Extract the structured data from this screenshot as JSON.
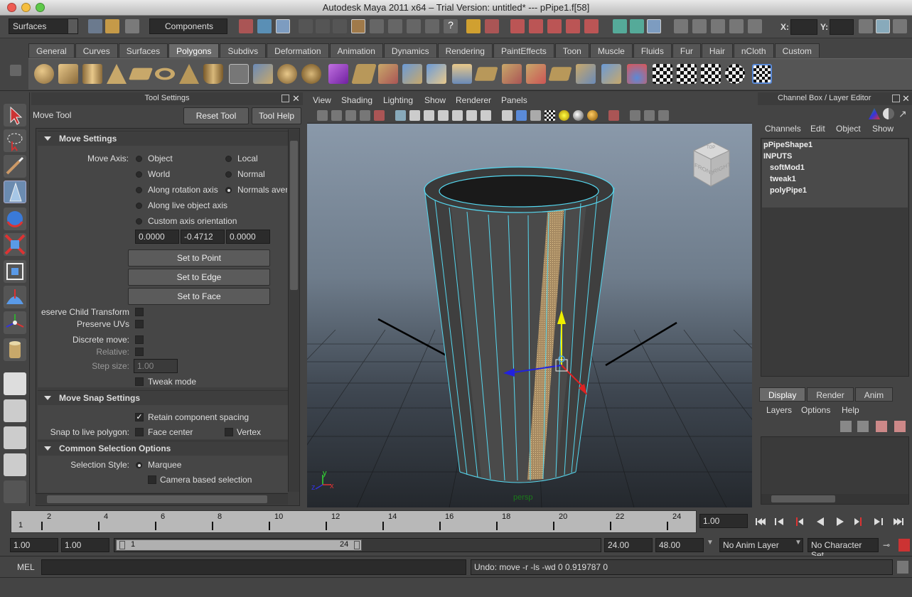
{
  "window": {
    "title": "Autodesk Maya 2011 x64 – Trial Version: untitled*   ---   pPipe1.f[58]",
    "traffic_colors": [
      "#ee5b52",
      "#f5be3f",
      "#5ec94a"
    ]
  },
  "statusline": {
    "menuset": "Surfaces",
    "selection_mode": "Components",
    "x_label": "X:",
    "y_label": "Y:"
  },
  "shelf": {
    "tabs": [
      "General",
      "Curves",
      "Surfaces",
      "Polygons",
      "Subdivs",
      "Deformation",
      "Animation",
      "Dynamics",
      "Rendering",
      "PaintEffects",
      "Toon",
      "Muscle",
      "Fluids",
      "Fur",
      "Hair",
      "nCloth",
      "Custom"
    ],
    "active_tab": "Polygons"
  },
  "tool_settings": {
    "panel_title": "Tool Settings",
    "tool_name": "Move Tool",
    "reset_label": "Reset Tool",
    "help_label": "Tool Help",
    "move_settings": {
      "header": "Move Settings",
      "move_axis_label": "Move Axis:",
      "opt_object": "Object",
      "opt_local": "Local",
      "opt_world": "World",
      "opt_normal": "Normal",
      "opt_rotation_axis": "Along rotation axis",
      "opt_normals_avg": "Normals aver",
      "opt_live_object": "Along live object axis",
      "opt_custom": "Custom axis orientation",
      "axis_x": "0.0000",
      "axis_y": "-0.4712",
      "axis_z": "0.0000",
      "set_point": "Set to Point",
      "set_edge": "Set to Edge",
      "set_face": "Set to Face",
      "preserve_child": "eserve Child Transform",
      "preserve_uvs": "Preserve UVs",
      "discrete_move": "Discrete move:",
      "relative": "Relative:",
      "step_size": "Step size:",
      "step_value": "1.00",
      "tweak_mode": "Tweak mode"
    },
    "snap_settings": {
      "header": "Move Snap Settings",
      "retain_spacing": "Retain component spacing",
      "snap_live": "Snap to live polygon:",
      "face_center": "Face center",
      "vertex": "Vertex"
    },
    "selection": {
      "header": "Common Selection Options",
      "style_label": "Selection Style:",
      "marquee": "Marquee",
      "camera_based": "Camera based selection"
    }
  },
  "viewport": {
    "menus": [
      "View",
      "Shading",
      "Lighting",
      "Show",
      "Renderer",
      "Panels"
    ],
    "camera_label": "persp",
    "viewcube_front": "FRONT",
    "viewcube_right": "RIGHT",
    "viewcube_top": "TOP",
    "axis_x": "x",
    "axis_y": "y",
    "axis_z": "z"
  },
  "channel_box": {
    "title": "Channel Box / Layer Editor",
    "menus": [
      "Channels",
      "Edit",
      "Object",
      "Show"
    ],
    "items": [
      "pPipeShape1",
      "INPUTS",
      "softMod1",
      "tweak1",
      "polyPipe1"
    ],
    "layer_tabs": [
      "Display",
      "Render",
      "Anim"
    ],
    "active_layer_tab": "Display",
    "layer_menus": [
      "Layers",
      "Options",
      "Help"
    ]
  },
  "timeline": {
    "ticks": [
      "2",
      "4",
      "6",
      "8",
      "10",
      "12",
      "14",
      "16",
      "18",
      "20",
      "22",
      "24"
    ],
    "start_label": "1",
    "current_frame": "1.00"
  },
  "range": {
    "start_time": "1.00",
    "playback_start": "1.00",
    "range_start": "1",
    "range_end": "24",
    "playback_end": "24.00",
    "end_time": "48.00",
    "anim_layer": "No Anim Layer",
    "char_set": "No Character Set"
  },
  "command_line": {
    "lang": "MEL",
    "result": "Undo: move -r -ls -wd 0 0.919787 0"
  }
}
